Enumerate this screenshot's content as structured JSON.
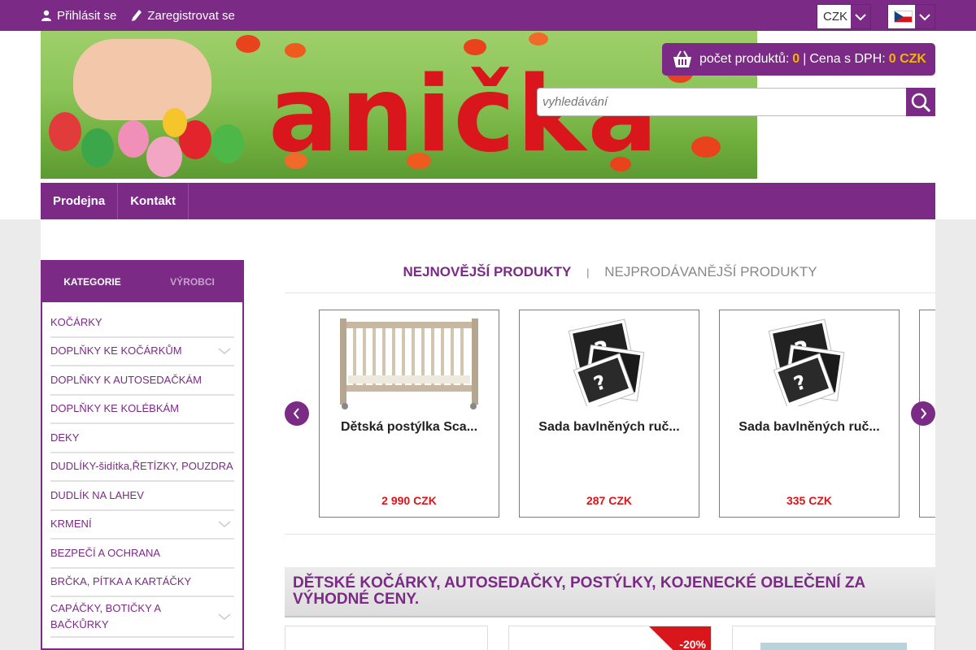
{
  "topbar": {
    "login_label": "Přihlásit se",
    "register_label": "Zaregistrovat se",
    "currency": "CZK",
    "language_flag": "cz-flag-icon"
  },
  "header": {
    "logo_text": "anička",
    "cart": {
      "count_label": "počet produktů:",
      "count_value": "0",
      "separator": "|",
      "price_label": "Cena s DPH:",
      "price_value": "0 CZK"
    },
    "search": {
      "placeholder": "vyhledávání"
    },
    "nav": [
      {
        "label": "Prodejna"
      },
      {
        "label": "Kontakt"
      }
    ]
  },
  "sidebar": {
    "tabs": [
      {
        "label": "KATEGORIE"
      },
      {
        "label": "VÝROBCI"
      }
    ],
    "items": [
      {
        "label": "KOČÁRKY",
        "has_children": false
      },
      {
        "label": "DOPLŇKY KE KOČÁRKŮM",
        "has_children": true
      },
      {
        "label": "DOPLŇKY K AUTOSEDAČKÁM",
        "has_children": false
      },
      {
        "label": "DOPLŇKY KE KOLÉBKÁM",
        "has_children": false
      },
      {
        "label": "DEKY",
        "has_children": false
      },
      {
        "label": "DUDLÍKY-šidítka,ŘETÍZKY, POUZDRA",
        "has_children": false
      },
      {
        "label": "DUDLÍK NA LAHEV",
        "has_children": false
      },
      {
        "label": "KRMENÍ",
        "has_children": true
      },
      {
        "label": "BEZPEČÍ A OCHRANA",
        "has_children": false
      },
      {
        "label": "BRČKA, PÍTKA A KARTÁČKY",
        "has_children": false
      },
      {
        "label": "CAPÁČKY, BOTIČKY A BAČKŮRKY",
        "has_children": true
      }
    ]
  },
  "products_tabs": {
    "active": "NEJNOVĚJŠÍ PRODUKTY",
    "separator": "|",
    "inactive": "NEJPRODÁVANĚJŠÍ PRODUKTY"
  },
  "carousel": [
    {
      "name": "Dětská postýlka Sca...",
      "price": "2 990 CZK",
      "image": "crib-image"
    },
    {
      "name": "Sada bavlněných ruč...",
      "price": "287 CZK",
      "image": "no-photo-icon"
    },
    {
      "name": "Sada bavlněných ruč...",
      "price": "335 CZK",
      "image": "no-photo-icon"
    }
  ],
  "seo_heading": "DĚTSKÉ KOČÁRKY, AUTOSEDAČKY, POSTÝLKY, KOJENECKÉ OBLEČENÍ ZA VÝHODNÉ CENY.",
  "product_grid": [
    {
      "badge": ""
    },
    {
      "badge": "-20%"
    },
    {
      "badge": ""
    }
  ],
  "colors": {
    "brand_purple": "#7b2a86",
    "accent_yellow": "#f5b400",
    "price_red": "#d9161c"
  }
}
